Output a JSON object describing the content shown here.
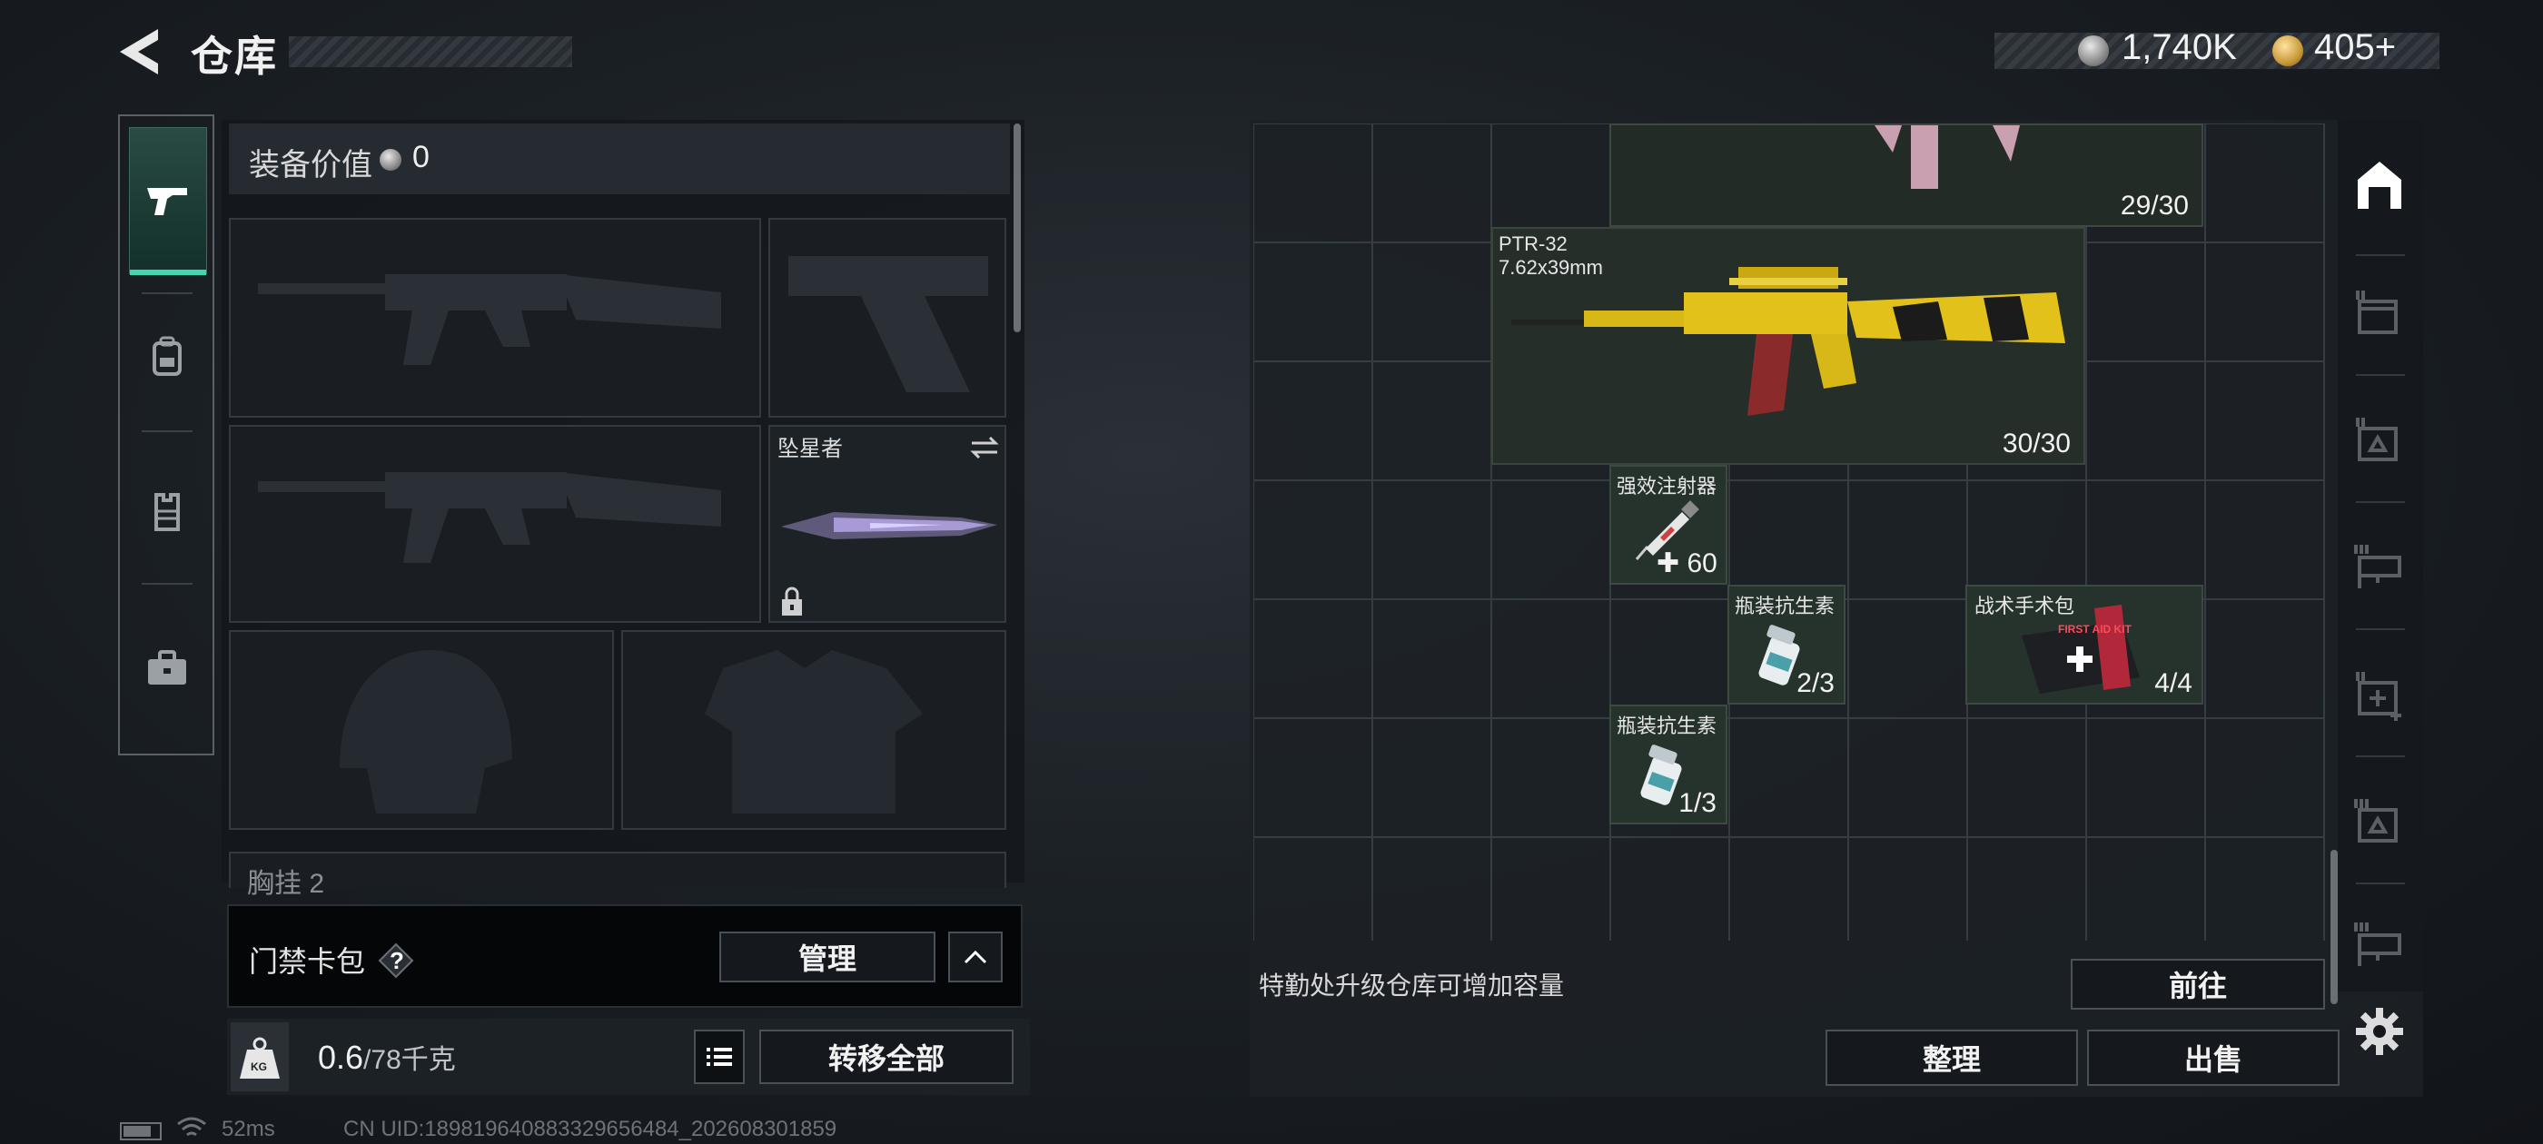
{
  "header": {
    "title": "仓库",
    "currency_silver": "1,740K",
    "currency_gold": "405+"
  },
  "tabs": [
    {
      "name": "weapons",
      "icon": "pistol-icon",
      "active": true
    },
    {
      "name": "backpack",
      "icon": "backpack-icon",
      "active": false
    },
    {
      "name": "vest",
      "icon": "vest-icon",
      "active": false
    },
    {
      "name": "toolbox",
      "icon": "briefcase-icon",
      "active": false
    }
  ],
  "loadout": {
    "equip_value_label": "装备价值",
    "equip_value": "0",
    "melee_name": "坠星者",
    "chest_label": "胸挂",
    "chest_suffix": "2"
  },
  "keycard": {
    "label": "门禁卡包",
    "help": "?",
    "manage_label": "管理"
  },
  "weight": {
    "current": "0.6",
    "max": "/78千克",
    "kg_badge": "KG",
    "transfer_all": "转移全部"
  },
  "status": {
    "ping": "52ms",
    "uid": "CN UID:1898196408833296564​84_202608301859"
  },
  "stash": {
    "items": [
      {
        "id": "top-weapon",
        "count": "29/30"
      },
      {
        "id": "ptr32",
        "name": "PTR-32",
        "caliber": "7.62x39mm",
        "count": "30/30"
      },
      {
        "id": "injector",
        "name": "强效注射器",
        "count": "60"
      },
      {
        "id": "antibiotic-1",
        "name": "瓶装抗生素",
        "count": "2/3"
      },
      {
        "id": "surgery-kit",
        "name": "战术手术包",
        "count": "4/4",
        "kit_text": "FIRST AID KIT"
      },
      {
        "id": "antibiotic-2",
        "name": "瓶装抗生素",
        "count": "1/3"
      }
    ],
    "hint": "特勤处升级仓库可增加容量",
    "goto_label": "前往",
    "sort_label": "整理",
    "sell_label": "出售"
  },
  "colors": {
    "accent": "#43d6b0",
    "item_bg": "#26322c",
    "gold_weapon": "#e2c21a",
    "mag_red": "#8a2a2a"
  }
}
